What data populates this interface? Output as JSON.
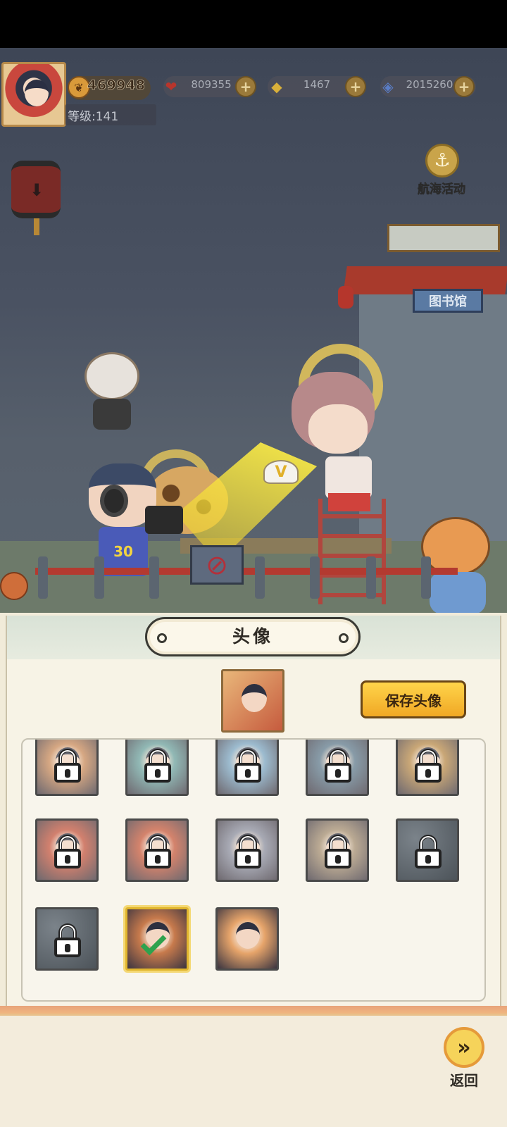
{
  "hud": {
    "coins": "469948",
    "level": "等级:141",
    "resources": [
      {
        "icon": "heart-icon",
        "value": "809355"
      },
      {
        "icon": "gold-ingot-icon",
        "value": "1467"
      },
      {
        "icon": "crystal-icon",
        "value": "2015260"
      }
    ],
    "plus_glyph": "+"
  },
  "scene": {
    "voyage_label": "航海活动",
    "library_sign": "图书馆",
    "jersey_number": "30",
    "cap_letter": "V"
  },
  "panel": {
    "title": "头像",
    "save_label": "保存头像",
    "back_label": "返回",
    "avatar_grid": [
      {
        "state": "locked",
        "palette": "#c98a5a"
      },
      {
        "state": "locked",
        "palette": "#6aa2a0"
      },
      {
        "state": "locked",
        "palette": "#7aa6c4"
      },
      {
        "state": "locked",
        "palette": "#5d7a8e"
      },
      {
        "state": "locked",
        "palette": "#b88a4a"
      },
      {
        "state": "locked",
        "palette": "#c4543e"
      },
      {
        "state": "locked",
        "palette": "#c7583c"
      },
      {
        "state": "locked",
        "palette": "#8a8ea0"
      },
      {
        "state": "locked",
        "palette": "#a48e72"
      },
      {
        "state": "locked-empty",
        "palette": "#5a6168"
      },
      {
        "state": "locked-empty",
        "palette": "#5a6168"
      },
      {
        "state": "selected",
        "palette": "#c77a4c"
      },
      {
        "state": "unlocked",
        "palette": "#e6a46a"
      }
    ]
  }
}
